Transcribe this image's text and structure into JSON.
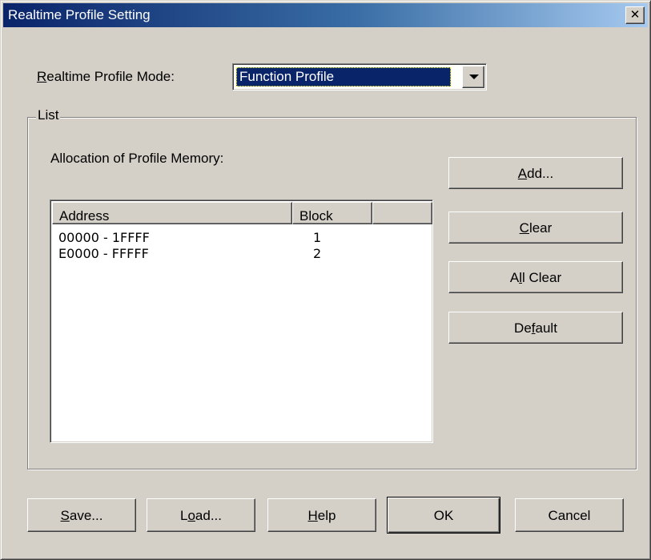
{
  "window": {
    "title": "Realtime Profile Setting",
    "close_glyph": "✕"
  },
  "mode": {
    "label_accel": "R",
    "label_rest": "ealtime Profile Mode:",
    "selected": "Function Profile"
  },
  "list_group": {
    "legend": "List",
    "allocation_label": "Allocation of Profile Memory:",
    "columns": [
      "Address",
      "Block"
    ],
    "rows": [
      {
        "address": "00000 - 1FFFF",
        "block": "1"
      },
      {
        "address": "E0000 - FFFFF",
        "block": "2"
      }
    ]
  },
  "side_buttons": {
    "add": {
      "accel": "A",
      "rest": "dd..."
    },
    "clear": {
      "accel": "C",
      "rest": "lear"
    },
    "all_clear": {
      "pre": "A",
      "accel": "l",
      "rest": "l Clear"
    },
    "default": {
      "pre": "De",
      "accel": "f",
      "rest": "ault"
    }
  },
  "bottom_buttons": {
    "save": {
      "pre": "",
      "accel": "S",
      "rest": "ave..."
    },
    "load": {
      "pre": "L",
      "accel": "o",
      "rest": "ad..."
    },
    "help": {
      "pre": "",
      "accel": "H",
      "rest": "elp"
    },
    "ok": "OK",
    "cancel": "Cancel"
  },
  "colors": {
    "face": "#d4d0c8",
    "title_start": "#0a246a",
    "title_end": "#a6caf0",
    "selection": "#0a246a"
  }
}
